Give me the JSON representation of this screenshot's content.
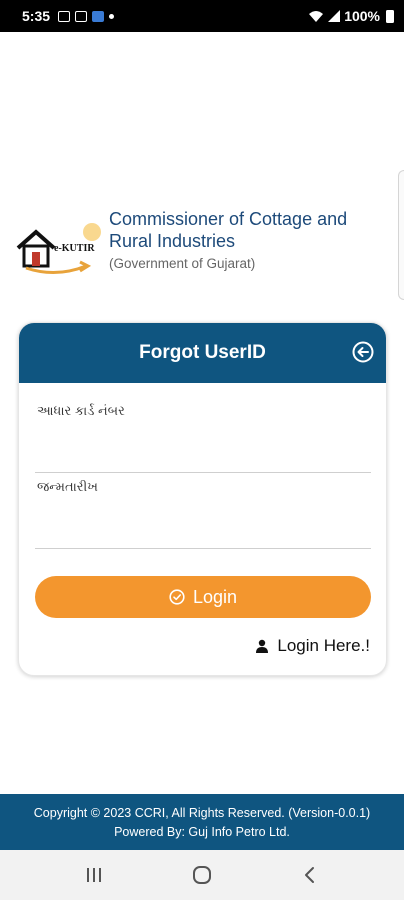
{
  "status_bar": {
    "time": "5:35",
    "battery_text": "100%",
    "icons": [
      "gallery-icon",
      "news-icon",
      "cloud-icon",
      "notification-dot-icon",
      "wifi-icon",
      "signal-icon",
      "battery-icon"
    ]
  },
  "header": {
    "logo_text": "e-KUTIR",
    "org_title": "Commissioner of Cottage and Rural Industries",
    "org_subtitle": "(Government of Gujarat)"
  },
  "card": {
    "title": "Forgot UserID",
    "back_icon": "back-arrow-circle-icon",
    "fields": [
      {
        "label": "આધાર કાર્ડ નંબર",
        "value": ""
      },
      {
        "label": "જન્મતારીખ",
        "value": ""
      }
    ],
    "login_button": "Login",
    "login_here_link": "Login Here.!"
  },
  "footer": {
    "line1": "Copyright © 2023 CCRI, All Rights Reserved. (Version-0.0.1)",
    "line2": "Powered By: Guj Info Petro Ltd."
  },
  "colors": {
    "primary": "#0f5580",
    "accent": "#f3962e",
    "title_text": "#1d4a7a"
  },
  "nav_bar": [
    "recents-icon",
    "home-icon",
    "back-icon"
  ]
}
